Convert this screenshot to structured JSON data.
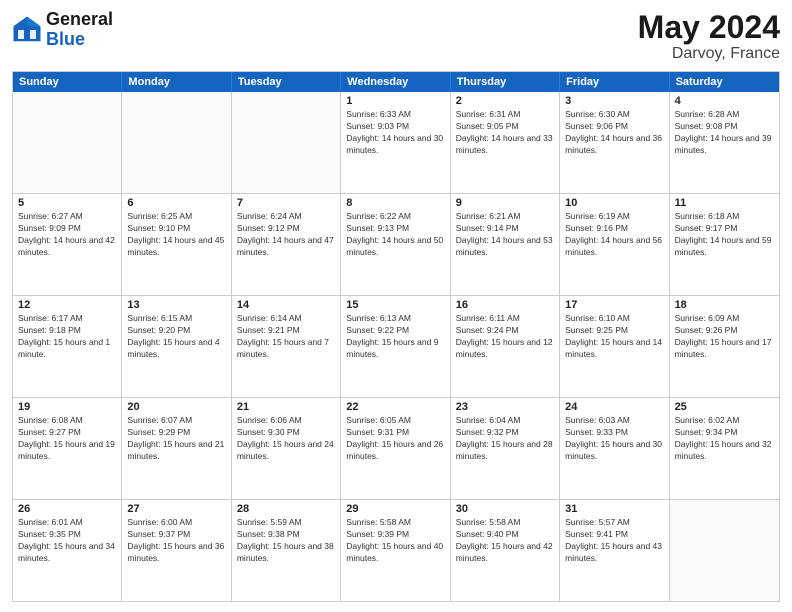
{
  "logo": {
    "text_general": "General",
    "text_blue": "Blue"
  },
  "header": {
    "title": "May 2024",
    "subtitle": "Darvoy, France"
  },
  "days_of_week": [
    "Sunday",
    "Monday",
    "Tuesday",
    "Wednesday",
    "Thursday",
    "Friday",
    "Saturday"
  ],
  "weeks": [
    [
      {
        "day": "",
        "empty": true
      },
      {
        "day": "",
        "empty": true
      },
      {
        "day": "",
        "empty": true
      },
      {
        "day": "1",
        "sunrise": "Sunrise: 6:33 AM",
        "sunset": "Sunset: 9:03 PM",
        "daylight": "Daylight: 14 hours and 30 minutes."
      },
      {
        "day": "2",
        "sunrise": "Sunrise: 6:31 AM",
        "sunset": "Sunset: 9:05 PM",
        "daylight": "Daylight: 14 hours and 33 minutes."
      },
      {
        "day": "3",
        "sunrise": "Sunrise: 6:30 AM",
        "sunset": "Sunset: 9:06 PM",
        "daylight": "Daylight: 14 hours and 36 minutes."
      },
      {
        "day": "4",
        "sunrise": "Sunrise: 6:28 AM",
        "sunset": "Sunset: 9:08 PM",
        "daylight": "Daylight: 14 hours and 39 minutes."
      }
    ],
    [
      {
        "day": "5",
        "sunrise": "Sunrise: 6:27 AM",
        "sunset": "Sunset: 9:09 PM",
        "daylight": "Daylight: 14 hours and 42 minutes."
      },
      {
        "day": "6",
        "sunrise": "Sunrise: 6:25 AM",
        "sunset": "Sunset: 9:10 PM",
        "daylight": "Daylight: 14 hours and 45 minutes."
      },
      {
        "day": "7",
        "sunrise": "Sunrise: 6:24 AM",
        "sunset": "Sunset: 9:12 PM",
        "daylight": "Daylight: 14 hours and 47 minutes."
      },
      {
        "day": "8",
        "sunrise": "Sunrise: 6:22 AM",
        "sunset": "Sunset: 9:13 PM",
        "daylight": "Daylight: 14 hours and 50 minutes."
      },
      {
        "day": "9",
        "sunrise": "Sunrise: 6:21 AM",
        "sunset": "Sunset: 9:14 PM",
        "daylight": "Daylight: 14 hours and 53 minutes."
      },
      {
        "day": "10",
        "sunrise": "Sunrise: 6:19 AM",
        "sunset": "Sunset: 9:16 PM",
        "daylight": "Daylight: 14 hours and 56 minutes."
      },
      {
        "day": "11",
        "sunrise": "Sunrise: 6:18 AM",
        "sunset": "Sunset: 9:17 PM",
        "daylight": "Daylight: 14 hours and 59 minutes."
      }
    ],
    [
      {
        "day": "12",
        "sunrise": "Sunrise: 6:17 AM",
        "sunset": "Sunset: 9:18 PM",
        "daylight": "Daylight: 15 hours and 1 minute."
      },
      {
        "day": "13",
        "sunrise": "Sunrise: 6:15 AM",
        "sunset": "Sunset: 9:20 PM",
        "daylight": "Daylight: 15 hours and 4 minutes."
      },
      {
        "day": "14",
        "sunrise": "Sunrise: 6:14 AM",
        "sunset": "Sunset: 9:21 PM",
        "daylight": "Daylight: 15 hours and 7 minutes."
      },
      {
        "day": "15",
        "sunrise": "Sunrise: 6:13 AM",
        "sunset": "Sunset: 9:22 PM",
        "daylight": "Daylight: 15 hours and 9 minutes."
      },
      {
        "day": "16",
        "sunrise": "Sunrise: 6:11 AM",
        "sunset": "Sunset: 9:24 PM",
        "daylight": "Daylight: 15 hours and 12 minutes."
      },
      {
        "day": "17",
        "sunrise": "Sunrise: 6:10 AM",
        "sunset": "Sunset: 9:25 PM",
        "daylight": "Daylight: 15 hours and 14 minutes."
      },
      {
        "day": "18",
        "sunrise": "Sunrise: 6:09 AM",
        "sunset": "Sunset: 9:26 PM",
        "daylight": "Daylight: 15 hours and 17 minutes."
      }
    ],
    [
      {
        "day": "19",
        "sunrise": "Sunrise: 6:08 AM",
        "sunset": "Sunset: 9:27 PM",
        "daylight": "Daylight: 15 hours and 19 minutes."
      },
      {
        "day": "20",
        "sunrise": "Sunrise: 6:07 AM",
        "sunset": "Sunset: 9:29 PM",
        "daylight": "Daylight: 15 hours and 21 minutes."
      },
      {
        "day": "21",
        "sunrise": "Sunrise: 6:06 AM",
        "sunset": "Sunset: 9:30 PM",
        "daylight": "Daylight: 15 hours and 24 minutes."
      },
      {
        "day": "22",
        "sunrise": "Sunrise: 6:05 AM",
        "sunset": "Sunset: 9:31 PM",
        "daylight": "Daylight: 15 hours and 26 minutes."
      },
      {
        "day": "23",
        "sunrise": "Sunrise: 6:04 AM",
        "sunset": "Sunset: 9:32 PM",
        "daylight": "Daylight: 15 hours and 28 minutes."
      },
      {
        "day": "24",
        "sunrise": "Sunrise: 6:03 AM",
        "sunset": "Sunset: 9:33 PM",
        "daylight": "Daylight: 15 hours and 30 minutes."
      },
      {
        "day": "25",
        "sunrise": "Sunrise: 6:02 AM",
        "sunset": "Sunset: 9:34 PM",
        "daylight": "Daylight: 15 hours and 32 minutes."
      }
    ],
    [
      {
        "day": "26",
        "sunrise": "Sunrise: 6:01 AM",
        "sunset": "Sunset: 9:35 PM",
        "daylight": "Daylight: 15 hours and 34 minutes."
      },
      {
        "day": "27",
        "sunrise": "Sunrise: 6:00 AM",
        "sunset": "Sunset: 9:37 PM",
        "daylight": "Daylight: 15 hours and 36 minutes."
      },
      {
        "day": "28",
        "sunrise": "Sunrise: 5:59 AM",
        "sunset": "Sunset: 9:38 PM",
        "daylight": "Daylight: 15 hours and 38 minutes."
      },
      {
        "day": "29",
        "sunrise": "Sunrise: 5:58 AM",
        "sunset": "Sunset: 9:39 PM",
        "daylight": "Daylight: 15 hours and 40 minutes."
      },
      {
        "day": "30",
        "sunrise": "Sunrise: 5:58 AM",
        "sunset": "Sunset: 9:40 PM",
        "daylight": "Daylight: 15 hours and 42 minutes."
      },
      {
        "day": "31",
        "sunrise": "Sunrise: 5:57 AM",
        "sunset": "Sunset: 9:41 PM",
        "daylight": "Daylight: 15 hours and 43 minutes."
      },
      {
        "day": "",
        "empty": true
      }
    ]
  ]
}
